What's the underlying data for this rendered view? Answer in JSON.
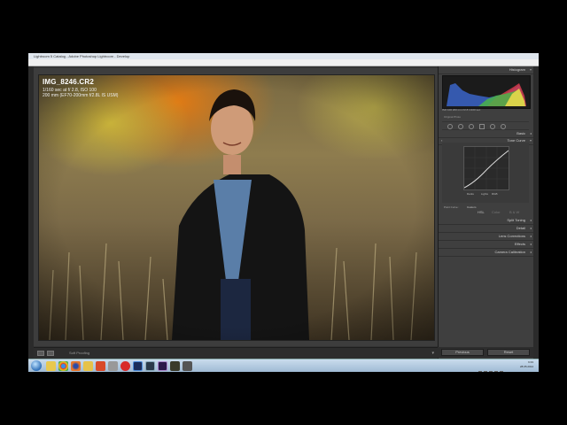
{
  "window": {
    "title": "Lightroom 5 Catalog - Adobe Photoshop Lightroom - Develop"
  },
  "menu": [
    "File",
    "Edit",
    "Develop",
    "Photo",
    "Settings",
    "Tools",
    "View",
    "Window",
    "Help"
  ],
  "photo_info": {
    "filename": "IMG_8246.CR2",
    "line1": "1/160 sec at f/ 2.8, ISO 100",
    "line2": "200 mm (EF70-200mm f/2.8L IS USM)"
  },
  "toolbar": {
    "view_label": "Soft Proofing"
  },
  "panels": {
    "histogram": "Histogram",
    "histogram_footer": "ISO 100   200 mm   f/2.8   1/160 sec",
    "original_photo": "Original Photo",
    "basic": "Basic",
    "tone_curve": "Tone Curve",
    "curve_labels": [
      "Darks",
      "Lights",
      "RGB"
    ],
    "point_curve_label": "Point Curve :",
    "point_curve_value": "Custom",
    "hsl": "HSL",
    "hsl_color": "Color",
    "hsl_bw": "B & W",
    "split_toning": "Split Toning",
    "detail": "Detail",
    "lens_corrections": "Lens Corrections",
    "effects": "Effects",
    "camera_calibration": "Camera Calibration"
  },
  "buttons": {
    "previous": "Previous",
    "reset": "Reset"
  },
  "taskbar": {
    "time": "9:33",
    "date": "28.05.2014",
    "apps": [
      "windows-explorer-icon",
      "chrome-icon",
      "firefox-icon",
      "folder-icon",
      "media-player-icon",
      "settings-icon",
      "opera-icon",
      "photoshop-icon",
      "lightroom-icon",
      "premiere-icon",
      "game-icon",
      "app-icon"
    ]
  },
  "colors": {
    "accent_blue": "#2f6fb8",
    "panel_bg": "#3f3f3f",
    "canvas_bg": "#3d3d3d"
  }
}
